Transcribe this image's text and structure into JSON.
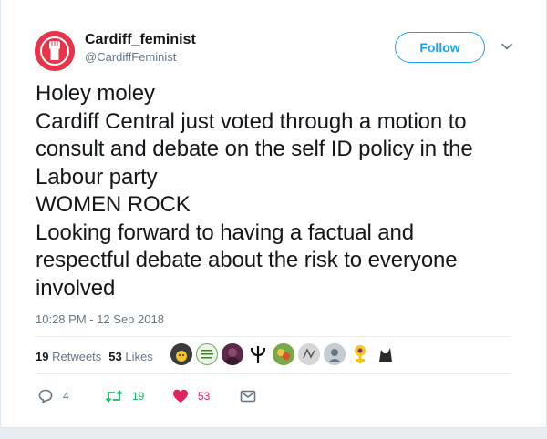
{
  "user": {
    "display_name": "Cardiff_feminist",
    "handle": "@CardiffFeminist"
  },
  "follow_label": "Follow",
  "tweet": {
    "lines": [
      "Holey moley",
      "Cardiff Central just voted through a motion to",
      "consult and debate on the self ID policy in the",
      "Labour party",
      "WOMEN ROCK",
      "Looking forward to having a factual and",
      "respectful debate about the risk to everyone",
      "involved"
    ],
    "timestamp": "10:28 PM - 12 Sep 2018"
  },
  "stats": {
    "retweets_count": "19",
    "retweets_label": "Retweets",
    "likes_count": "53",
    "likes_label": "Likes"
  },
  "actions": {
    "reply_count": "4",
    "retweet_count": "19",
    "like_count": "53"
  },
  "colors": {
    "brand_blue": "#1da1f2",
    "retweet_green": "#17bf63",
    "like_red": "#e0245e",
    "avatar_red": "#e8344b"
  }
}
